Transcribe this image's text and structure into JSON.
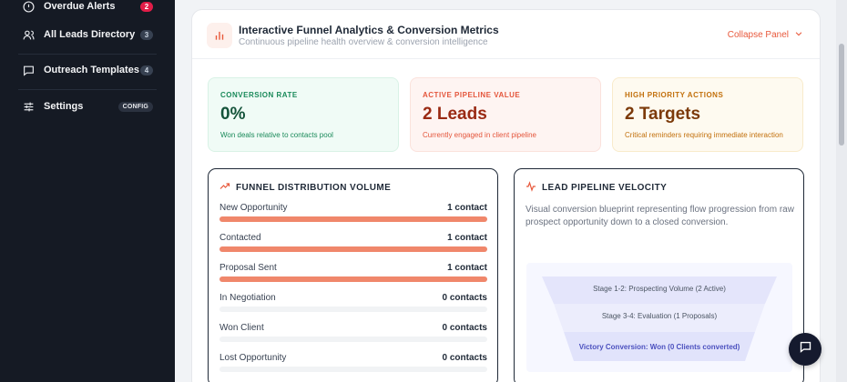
{
  "sidebar": {
    "items": [
      {
        "label": "Overdue Alerts",
        "badge": "2",
        "icon": "alert-circle-icon"
      },
      {
        "label": "All Leads Directory",
        "badge": "3",
        "icon": "users-icon"
      },
      {
        "label": "Outreach Templates",
        "badge": "4",
        "icon": "message-square-icon"
      },
      {
        "label": "Settings",
        "badge": "CONFIG",
        "icon": "sliders-icon"
      }
    ]
  },
  "panel": {
    "title": "Interactive Funnel Analytics & Conversion Metrics",
    "subtitle": "Continuous pipeline health overview & conversion intelligence",
    "collapse_label": "Collapse Panel"
  },
  "stats": [
    {
      "label": "CONVERSION RATE",
      "value": "0%",
      "note": "Won deals relative to contacts pool",
      "color": "#1a8a5a"
    },
    {
      "label": "ACTIVE PIPELINE VALUE",
      "value": "2 Leads",
      "note": "Currently engaged in client pipeline",
      "color": "#e4553b"
    },
    {
      "label": "HIGH PRIORITY ACTIONS",
      "value": "2 Targets",
      "note": "Critical reminders requiring immediate interaction",
      "color": "#c2700c"
    }
  ],
  "funnel": {
    "title": "FUNNEL DISTRIBUTION VOLUME",
    "bar_color": "#f0876b",
    "rows": [
      {
        "label": "New Opportunity",
        "count": "1 contact",
        "fill": 1.0
      },
      {
        "label": "Contacted",
        "count": "1 contact",
        "fill": 1.0
      },
      {
        "label": "Proposal Sent",
        "count": "1 contact",
        "fill": 1.0
      },
      {
        "label": "In Negotiation",
        "count": "0 contacts",
        "fill": 0
      },
      {
        "label": "Won Client",
        "count": "0 contacts",
        "fill": 0
      },
      {
        "label": "Lost Opportunity",
        "count": "0 contacts",
        "fill": 0
      }
    ]
  },
  "velocity": {
    "title": "LEAD PIPELINE VELOCITY",
    "description": "Visual conversion blueprint representing flow progression from raw prospect opportunity down to a closed conversion.",
    "stages": [
      "Stage 1-2: Prospecting Volume (2 Active)",
      "Stage 3-4: Evaluation (1 Proposals)",
      "Victory Conversion: Won (0 Clients converted)"
    ]
  }
}
